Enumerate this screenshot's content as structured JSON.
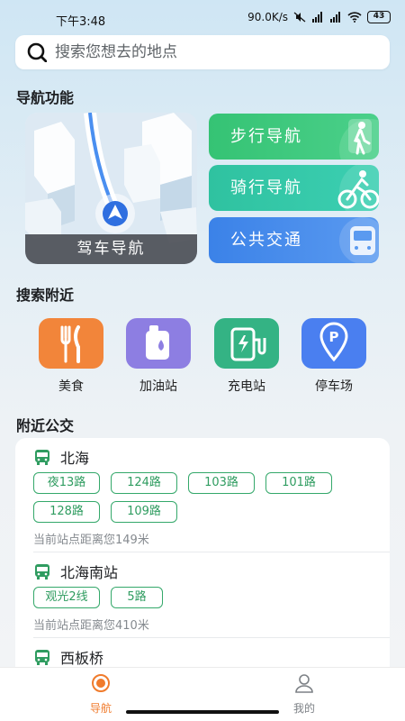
{
  "status_bar": {
    "time": "下午3:48",
    "network_speed": "90.0K/s",
    "battery": "43"
  },
  "search": {
    "placeholder": "搜索您想去的地点"
  },
  "nav_section": {
    "title": "导航功能",
    "drive_label": "驾车导航",
    "walk_label": "步行导航",
    "bike_label": "骑行导航",
    "transit_label": "公共交通"
  },
  "nearby_section": {
    "title": "搜索附近",
    "items": [
      {
        "label": "美食",
        "icon": "food-icon",
        "color": "#f2853a"
      },
      {
        "label": "加油站",
        "icon": "fuel-icon",
        "color": "#8d7ee2"
      },
      {
        "label": "充电站",
        "icon": "charging-icon",
        "color": "#34b384"
      },
      {
        "label": "停车场",
        "icon": "parking-icon",
        "color": "#4a7ff0"
      }
    ]
  },
  "bus_section": {
    "title": "附近公交",
    "stops": [
      {
        "name": "北海",
        "routes": [
          "夜13路",
          "124路",
          "103路",
          "101路",
          "128路",
          "109路"
        ],
        "distance": "当前站点距离您149米"
      },
      {
        "name": "北海南站",
        "routes": [
          "观光2线",
          "5路"
        ],
        "distance": "当前站点距离您410米"
      },
      {
        "name": "西板桥",
        "routes": [],
        "distance": ""
      }
    ]
  },
  "tabbar": {
    "nav_label": "导航",
    "mine_label": "我的",
    "active_color": "#f07b2c",
    "inactive_color": "#7d8186"
  }
}
